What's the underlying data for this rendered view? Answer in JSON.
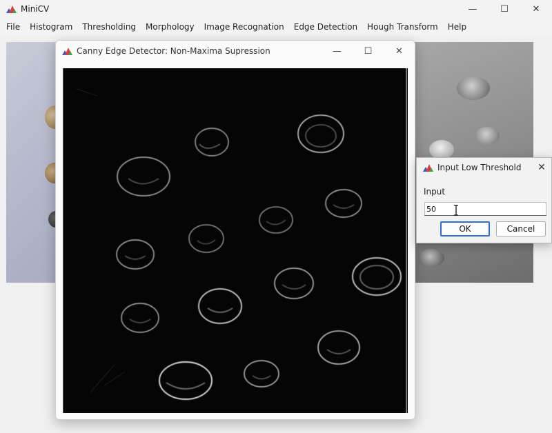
{
  "app": {
    "title": "MiniCV",
    "menu": [
      "File",
      "Histogram",
      "Thresholding",
      "Morphology",
      "Image Recognation",
      "Edge Detection",
      "Hough Transform",
      "Help"
    ],
    "window_controls": {
      "minimize": "—",
      "maximize": "☐",
      "close": "✕"
    }
  },
  "child_window": {
    "title": "Canny Edge Detector: Non-Maxima Supression",
    "image_description_icon": "edge-map",
    "controls": {
      "minimize": "—",
      "maximize": "☐",
      "close": "✕"
    }
  },
  "dialog": {
    "title": "Input Low Threshold",
    "label": "Input",
    "value": "50",
    "ok_label": "OK",
    "cancel_label": "Cancel",
    "close": "✕"
  },
  "colors": {
    "accent": "#2a6fd4",
    "edge_background": "#050505"
  }
}
